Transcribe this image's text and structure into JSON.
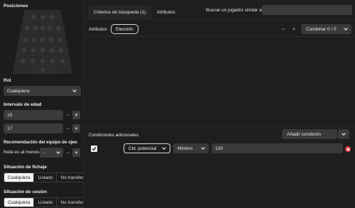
{
  "sidebar": {
    "positions_title": "Posiciones",
    "role": {
      "label": "Rol",
      "value": "Cualquiera"
    },
    "age_range": {
      "label": "Intervalo de edad",
      "min": "15",
      "max": "17"
    },
    "recommendation": {
      "label": "Recomendación del equipo de ojeo",
      "value": "Nota es al menos",
      "value2": "-"
    },
    "contract_status": {
      "label": "Situación de fichaje",
      "options": [
        "Cualquiera",
        "Listado",
        "No transferible"
      ],
      "active": 0
    },
    "loan_status": {
      "label": "Situación de cesión",
      "options": [
        "Cualquiera",
        "Listado",
        "No transferible"
      ],
      "active": 0
    }
  },
  "tabs": [
    {
      "label": "Criterios de búsqueda (1)",
      "active": true
    },
    {
      "label": "Atributos",
      "active": false
    }
  ],
  "search": {
    "label": "Buscar un jugador similar a",
    "value": ""
  },
  "attributes_bar": {
    "label": "Atributos",
    "selection_pill": "Elección",
    "combine_label": "Combinar 0 / 0"
  },
  "conditions": {
    "title": "Condiciones adicionales",
    "add_label": "Añadir condición",
    "rows": [
      {
        "checked": true,
        "attribute": "Cld. potencial",
        "operator": "Mínimo",
        "value": "120"
      }
    ]
  },
  "colors": {
    "remove": "#e0413f",
    "background": "#1a1a1a",
    "control": "#393939"
  }
}
